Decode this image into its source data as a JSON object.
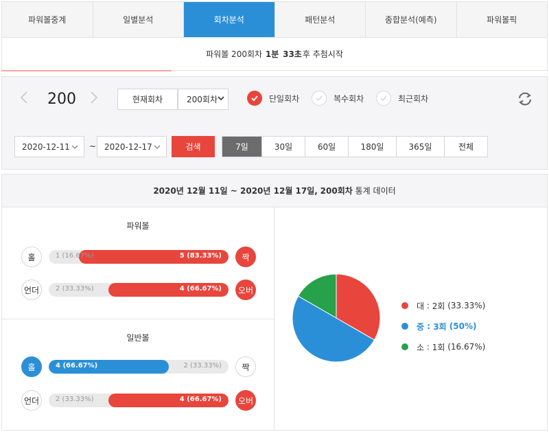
{
  "tabs": [
    {
      "label": "파워볼중계"
    },
    {
      "label": "일별분석"
    },
    {
      "label": "회차분석"
    },
    {
      "label": "패턴분석"
    },
    {
      "label": "종합분석(예측)"
    },
    {
      "label": "파워볼픽"
    }
  ],
  "active_tab": 2,
  "countdown": {
    "prefix": "파워볼 200회차",
    "minutes": "1분",
    "seconds": "33초",
    "suffix": "후 추첨시작"
  },
  "controls": {
    "round_number": "200",
    "current_round_button": "현재회차",
    "round_select": "200회차",
    "options": [
      {
        "label": "단일회차",
        "checked": true
      },
      {
        "label": "복수회차",
        "checked": false
      },
      {
        "label": "최근회차",
        "checked": false
      }
    ],
    "date_from": "2020-12-11",
    "date_separator": "~",
    "date_to": "2020-12-17",
    "search_button": "검색",
    "periods": [
      {
        "label": "7일",
        "active": true
      },
      {
        "label": "30일",
        "active": false
      },
      {
        "label": "60일",
        "active": false
      },
      {
        "label": "180일",
        "active": false
      },
      {
        "label": "365일",
        "active": false
      },
      {
        "label": "전체",
        "active": false
      }
    ]
  },
  "stats": {
    "header_date": "2020년 12월 11일 ~ 2020년 12월 17일,",
    "header_round": "200회차",
    "header_suffix": "통계 데이터",
    "powerball": {
      "title": "파워볼",
      "rows": [
        {
          "left_badge": "홀",
          "left_label": "1 (16.67%)",
          "right_label": "5 (83.33%)",
          "right_badge": "짝",
          "fill_side": "right",
          "fill_fraction": 0.8333,
          "fill_color": "#e8453c"
        },
        {
          "left_badge": "언더",
          "left_label": "2 (33.33%)",
          "right_label": "4 (66.67%)",
          "right_badge": "오버",
          "fill_side": "right",
          "fill_fraction": 0.6667,
          "fill_color": "#e8453c"
        }
      ]
    },
    "normalball": {
      "title": "일반볼",
      "rows": [
        {
          "left_badge": "홀",
          "left_label": "4 (66.67%)",
          "right_label": "2 (33.33%)",
          "right_badge": "짝",
          "fill_side": "left",
          "fill_fraction": 0.6667,
          "fill_color": "#2b8fd8"
        },
        {
          "left_badge": "언더",
          "left_label": "2 (33.33%)",
          "right_label": "4 (66.67%)",
          "right_badge": "오버",
          "fill_side": "right",
          "fill_fraction": 0.6667,
          "fill_color": "#e8453c"
        }
      ]
    }
  },
  "chart_data": {
    "type": "pie",
    "slices": [
      {
        "name": "대",
        "count": "2회",
        "percent": "(33.33%)",
        "value": 33.33,
        "color": "#e8453c"
      },
      {
        "name": "중",
        "count": "3회",
        "percent": "(50%)",
        "value": 50,
        "color": "#2b8fd8",
        "highlight": true
      },
      {
        "name": "소",
        "count": "1회",
        "percent": "(16.67%)",
        "value": 16.67,
        "color": "#27a14a"
      }
    ],
    "legend_placement": "right"
  },
  "icons": {
    "refresh": "refresh-icon",
    "check": "check-icon",
    "prev": "chevron-left-icon",
    "next": "chevron-right-icon"
  }
}
